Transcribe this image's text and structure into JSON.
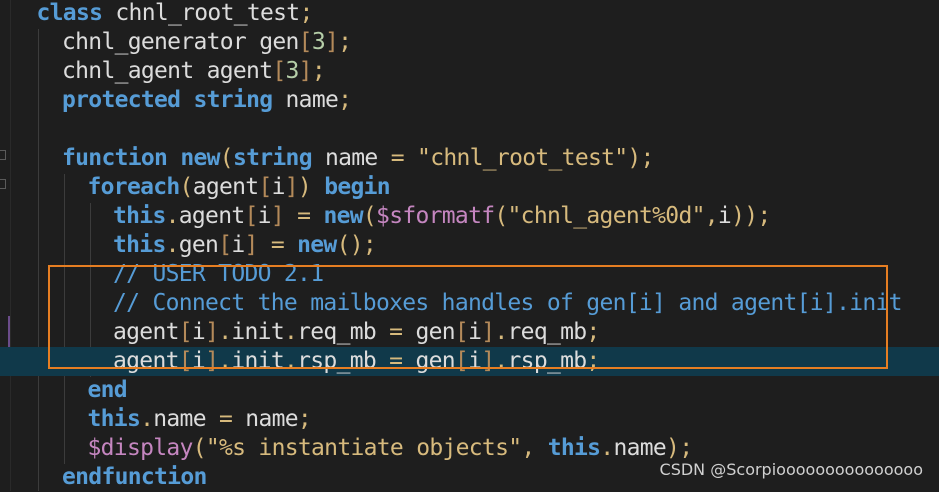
{
  "editor": {
    "lines": [
      {
        "indent": 1,
        "highlight": false,
        "tokens": [
          {
            "t": "kw",
            "v": "class"
          },
          {
            "t": "id",
            "v": " chnl_root_test"
          },
          {
            "t": "pun",
            "v": ";"
          }
        ]
      },
      {
        "indent": 2,
        "highlight": false,
        "tokens": [
          {
            "t": "id",
            "v": "chnl_generator gen"
          },
          {
            "t": "brk",
            "v": "["
          },
          {
            "t": "num",
            "v": "3"
          },
          {
            "t": "brk",
            "v": "]"
          },
          {
            "t": "pun",
            "v": ";"
          }
        ]
      },
      {
        "indent": 2,
        "highlight": false,
        "tokens": [
          {
            "t": "id",
            "v": "chnl_agent agent"
          },
          {
            "t": "brk",
            "v": "["
          },
          {
            "t": "num",
            "v": "3"
          },
          {
            "t": "brk",
            "v": "]"
          },
          {
            "t": "pun",
            "v": ";"
          }
        ]
      },
      {
        "indent": 2,
        "highlight": false,
        "tokens": [
          {
            "t": "kw",
            "v": "protected"
          },
          {
            "t": "id",
            "v": " "
          },
          {
            "t": "kw",
            "v": "string"
          },
          {
            "t": "id",
            "v": " name"
          },
          {
            "t": "pun",
            "v": ";"
          }
        ]
      },
      {
        "indent": 0,
        "highlight": false,
        "tokens": []
      },
      {
        "indent": 2,
        "highlight": false,
        "tokens": [
          {
            "t": "kw",
            "v": "function"
          },
          {
            "t": "id",
            "v": " "
          },
          {
            "t": "kw",
            "v": "new"
          },
          {
            "t": "pun",
            "v": "("
          },
          {
            "t": "kw",
            "v": "string"
          },
          {
            "t": "id",
            "v": " name "
          },
          {
            "t": "pun",
            "v": "="
          },
          {
            "t": "id",
            "v": " "
          },
          {
            "t": "str",
            "v": "\"chnl_root_test\""
          },
          {
            "t": "pun",
            "v": ");"
          }
        ]
      },
      {
        "indent": 3,
        "highlight": false,
        "tokens": [
          {
            "t": "kw",
            "v": "foreach"
          },
          {
            "t": "pun",
            "v": "("
          },
          {
            "t": "id",
            "v": "agent"
          },
          {
            "t": "brk",
            "v": "["
          },
          {
            "t": "id",
            "v": "i"
          },
          {
            "t": "brk",
            "v": "]"
          },
          {
            "t": "pun",
            "v": ")"
          },
          {
            "t": "id",
            "v": " "
          },
          {
            "t": "kw",
            "v": "begin"
          }
        ]
      },
      {
        "indent": 4,
        "highlight": false,
        "tokens": [
          {
            "t": "kw",
            "v": "this"
          },
          {
            "t": "pun",
            "v": "."
          },
          {
            "t": "id",
            "v": "agent"
          },
          {
            "t": "brk",
            "v": "["
          },
          {
            "t": "id",
            "v": "i"
          },
          {
            "t": "brk",
            "v": "]"
          },
          {
            "t": "id",
            "v": " "
          },
          {
            "t": "pun",
            "v": "="
          },
          {
            "t": "id",
            "v": " "
          },
          {
            "t": "kw",
            "v": "new"
          },
          {
            "t": "pun",
            "v": "("
          },
          {
            "t": "sys",
            "v": "$sformatf"
          },
          {
            "t": "pun",
            "v": "("
          },
          {
            "t": "str",
            "v": "\"chnl_agent%0d\""
          },
          {
            "t": "pun",
            "v": ","
          },
          {
            "t": "id",
            "v": "i"
          },
          {
            "t": "pun",
            "v": "));"
          }
        ]
      },
      {
        "indent": 4,
        "highlight": false,
        "tokens": [
          {
            "t": "kw",
            "v": "this"
          },
          {
            "t": "pun",
            "v": "."
          },
          {
            "t": "id",
            "v": "gen"
          },
          {
            "t": "brk",
            "v": "["
          },
          {
            "t": "id",
            "v": "i"
          },
          {
            "t": "brk",
            "v": "]"
          },
          {
            "t": "id",
            "v": " "
          },
          {
            "t": "pun",
            "v": "="
          },
          {
            "t": "id",
            "v": " "
          },
          {
            "t": "kw",
            "v": "new"
          },
          {
            "t": "pun",
            "v": "();"
          }
        ]
      },
      {
        "indent": 4,
        "highlight": false,
        "tokens": [
          {
            "t": "cmt",
            "v": "// USER TODO 2.1"
          }
        ]
      },
      {
        "indent": 4,
        "highlight": false,
        "tokens": [
          {
            "t": "cmt",
            "v": "// Connect the mailboxes handles of gen[i] and agent[i].init"
          }
        ]
      },
      {
        "indent": 4,
        "highlight": false,
        "tokens": [
          {
            "t": "id",
            "v": "agent"
          },
          {
            "t": "brk",
            "v": "["
          },
          {
            "t": "id",
            "v": "i"
          },
          {
            "t": "brk",
            "v": "]"
          },
          {
            "t": "pun",
            "v": "."
          },
          {
            "t": "id",
            "v": "init"
          },
          {
            "t": "pun",
            "v": "."
          },
          {
            "t": "id",
            "v": "req_mb "
          },
          {
            "t": "pun",
            "v": "="
          },
          {
            "t": "id",
            "v": " gen"
          },
          {
            "t": "brk",
            "v": "["
          },
          {
            "t": "id",
            "v": "i"
          },
          {
            "t": "brk",
            "v": "]"
          },
          {
            "t": "pun",
            "v": "."
          },
          {
            "t": "id",
            "v": "req_mb"
          },
          {
            "t": "pun",
            "v": ";"
          }
        ]
      },
      {
        "indent": 4,
        "highlight": true,
        "tokens": [
          {
            "t": "id",
            "v": "agent"
          },
          {
            "t": "brk",
            "v": "["
          },
          {
            "t": "id",
            "v": "i"
          },
          {
            "t": "brk",
            "v": "]"
          },
          {
            "t": "pun",
            "v": "."
          },
          {
            "t": "id",
            "v": "init"
          },
          {
            "t": "pun",
            "v": "."
          },
          {
            "t": "id",
            "v": "rsp_mb "
          },
          {
            "t": "pun",
            "v": "="
          },
          {
            "t": "id",
            "v": " gen"
          },
          {
            "t": "brk",
            "v": "["
          },
          {
            "t": "id",
            "v": "i"
          },
          {
            "t": "brk",
            "v": "]"
          },
          {
            "t": "pun",
            "v": "."
          },
          {
            "t": "id",
            "v": "rsp_mb"
          },
          {
            "t": "pun",
            "v": ";"
          }
        ]
      },
      {
        "indent": 3,
        "highlight": false,
        "tokens": [
          {
            "t": "kw",
            "v": "end"
          }
        ]
      },
      {
        "indent": 3,
        "highlight": false,
        "tokens": [
          {
            "t": "kw",
            "v": "this"
          },
          {
            "t": "pun",
            "v": "."
          },
          {
            "t": "id",
            "v": "name "
          },
          {
            "t": "pun",
            "v": "="
          },
          {
            "t": "id",
            "v": " name"
          },
          {
            "t": "pun",
            "v": ";"
          }
        ]
      },
      {
        "indent": 3,
        "highlight": false,
        "tokens": [
          {
            "t": "sys",
            "v": "$display"
          },
          {
            "t": "pun",
            "v": "("
          },
          {
            "t": "str",
            "v": "\"%s instantiate objects\""
          },
          {
            "t": "pun",
            "v": ","
          },
          {
            "t": "id",
            "v": " "
          },
          {
            "t": "kw",
            "v": "this"
          },
          {
            "t": "pun",
            "v": "."
          },
          {
            "t": "id",
            "v": "name"
          },
          {
            "t": "pun",
            "v": ");"
          }
        ]
      },
      {
        "indent": 2,
        "highlight": false,
        "tokens": [
          {
            "t": "kw",
            "v": "endfunction"
          }
        ]
      }
    ]
  },
  "watermark": "CSDN @Scorpiooooooooooooooo",
  "colors": {
    "background": "#1e1e1e",
    "keyword": "#569cd6",
    "identifier": "#dcdcdc",
    "string": "#d7ba7d",
    "system_task": "#c586c0",
    "number": "#b5cea8",
    "current_line": "#10394a",
    "annotation_box": "#e67e22"
  }
}
